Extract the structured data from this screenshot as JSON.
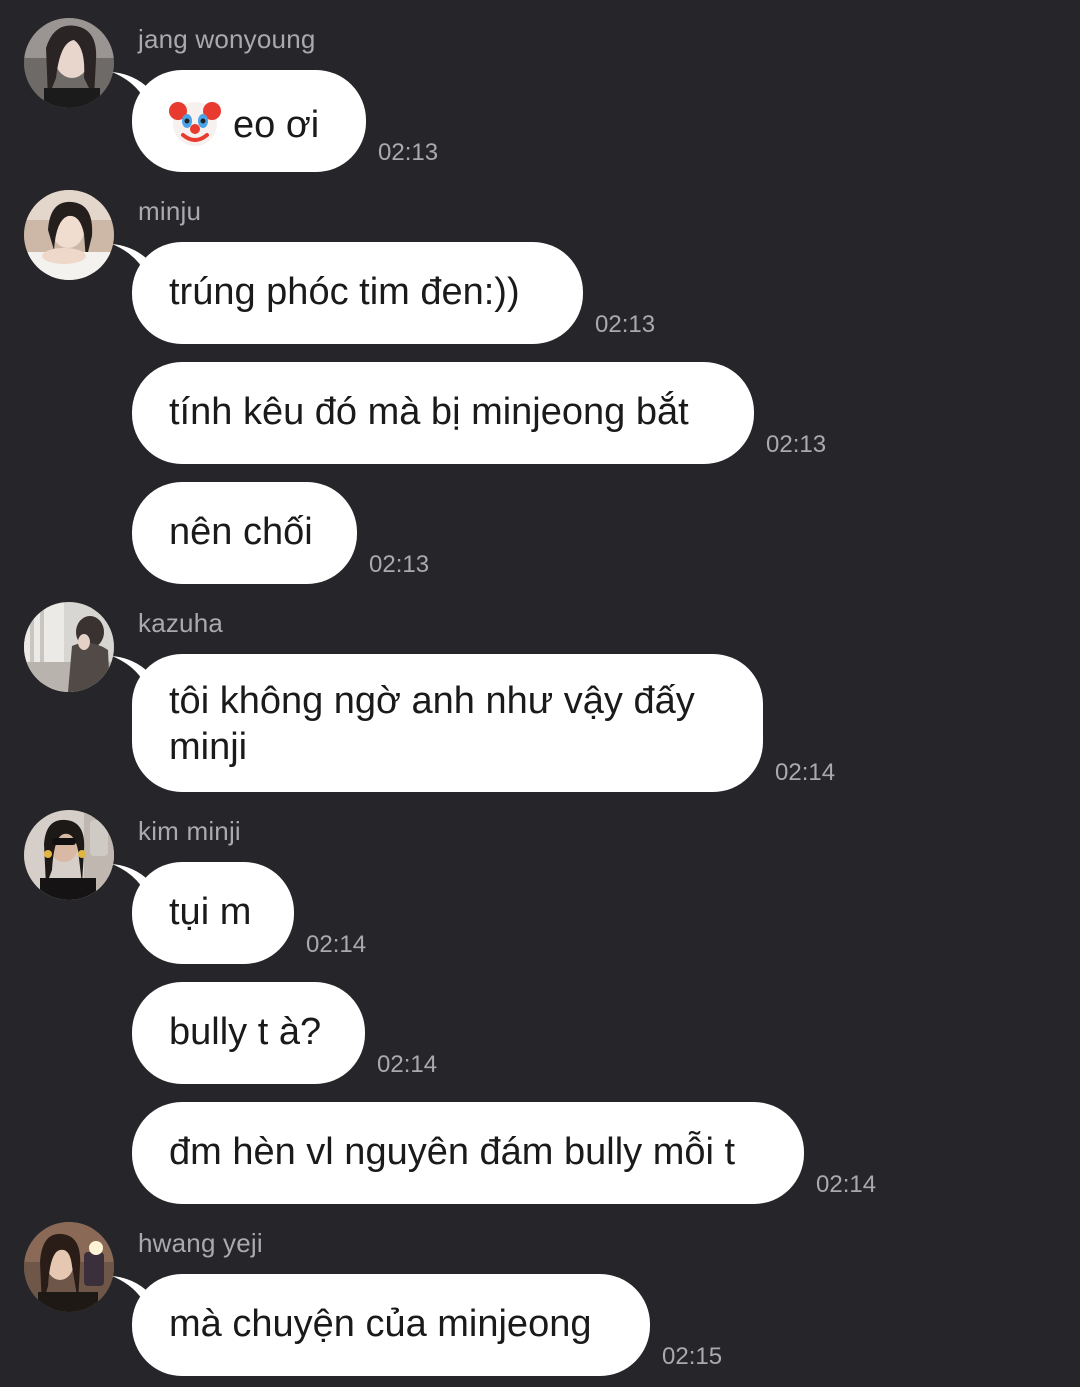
{
  "messages": [
    {
      "sender": "jang wonyoung",
      "avatar": "avatar-jang-wonyoung",
      "text": "eo ơi",
      "emoji": "clown-face-icon",
      "time": "02:13"
    },
    {
      "sender": "minju",
      "avatar": "avatar-minju",
      "text": "trúng phóc tim đen:))",
      "time": "02:13"
    },
    {
      "text": "tính kêu đó mà bị minjeong bắt",
      "time": "02:13"
    },
    {
      "text": "nên chối",
      "time": "02:13"
    },
    {
      "sender": "kazuha",
      "avatar": "avatar-kazuha",
      "text_line1": "tôi không ngờ anh như vậy đấy",
      "text_line2": "minji",
      "time": "02:14"
    },
    {
      "sender": "kim minji",
      "avatar": "avatar-kim-minji",
      "text": "tụi m",
      "time": "02:14"
    },
    {
      "text": "bully t à?",
      "time": "02:14"
    },
    {
      "text": "đm hèn vl nguyên đám bully mỗi t",
      "time": "02:14"
    },
    {
      "sender": "hwang yeji",
      "avatar": "avatar-hwang-yeji",
      "text": "mà chuyện của minjeong",
      "time": "02:15"
    }
  ],
  "colors": {
    "background": "#26262a",
    "bubble": "#ffffff",
    "meta_text": "#a9a9ae",
    "message_text": "#1a1a1a"
  }
}
